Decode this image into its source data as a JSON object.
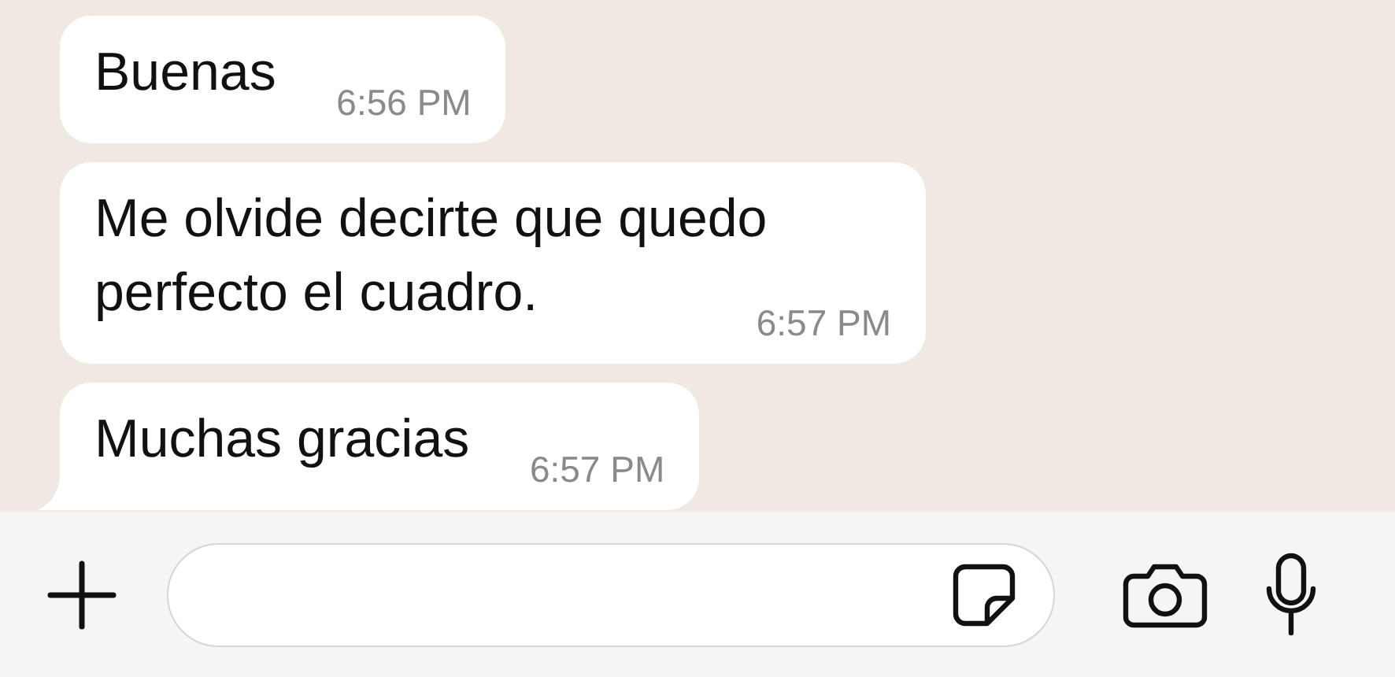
{
  "messages": [
    {
      "text": "Buenas",
      "time": "6:56 PM",
      "tail": false
    },
    {
      "text": "Me olvide decirte que quedo perfecto el cuadro.",
      "time": "6:57 PM",
      "tail": false
    },
    {
      "text": "Muchas gracias",
      "time": "6:57 PM",
      "tail": true
    }
  ]
}
